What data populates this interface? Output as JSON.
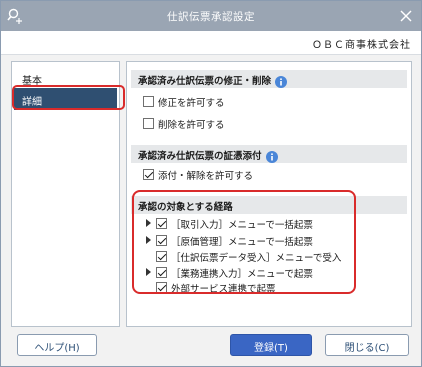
{
  "window": {
    "title": "仕訳伝票承認設定"
  },
  "company": {
    "name": "ＯＢＣ商事株式会社"
  },
  "sidebar": {
    "items": [
      {
        "label": "基本",
        "selected": false
      },
      {
        "label": "詳細",
        "selected": true
      }
    ]
  },
  "sections": {
    "modify_delete": {
      "title": "承認済み仕訳伝票の修正・削除",
      "options": [
        {
          "label": "修正を許可する",
          "checked": false
        },
        {
          "label": "削除を許可する",
          "checked": false
        }
      ]
    },
    "evidence": {
      "title": "承認済み仕訳伝票の証憑添付",
      "options": [
        {
          "label": "添付・解除を許可する",
          "checked": true
        }
      ]
    },
    "routes": {
      "title": "承認の対象とする経路",
      "items": [
        {
          "label": "［取引入力］メニューで一括起票",
          "checked": true,
          "expandable": true
        },
        {
          "label": "［原価管理］メニューで一括起票",
          "checked": true,
          "expandable": true
        },
        {
          "label": "［仕訳伝票データ受入］メニューで受入",
          "checked": true,
          "expandable": false
        },
        {
          "label": "［業務連携入力］メニューで起票",
          "checked": true,
          "expandable": true
        },
        {
          "label": "外部サービス連携で起票",
          "checked": true,
          "expandable": false
        }
      ]
    }
  },
  "buttons": {
    "help": "ヘルプ(H)",
    "register": "登録(T)",
    "close": "閉じる(C)"
  },
  "colors": {
    "accent": "#3a66c4",
    "selected_nav": "#2f4f71",
    "highlight": "#d92b2b"
  }
}
